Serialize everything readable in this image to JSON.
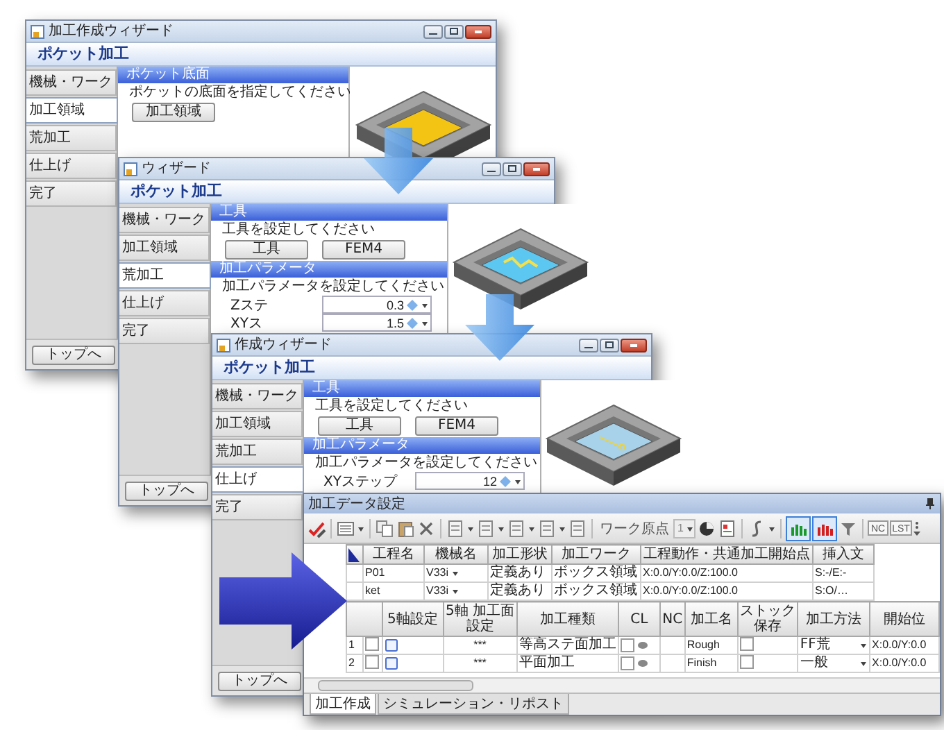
{
  "windows": [
    {
      "title": "加工作成ウィザード",
      "heading": "ポケット加工",
      "steps": [
        {
          "label": "機械・ワーク",
          "selected": false
        },
        {
          "label": "加工領域",
          "selected": true
        },
        {
          "label": "荒加工",
          "selected": false
        },
        {
          "label": "仕上げ",
          "selected": false
        },
        {
          "label": "完了",
          "selected": false
        }
      ],
      "sections": [
        {
          "title": "ポケット底面",
          "rows": [
            {
              "kind": "text",
              "text": "ポケットの底面を指定してください"
            },
            {
              "kind": "buttons",
              "buttons": [
                "加工領域"
              ]
            }
          ]
        }
      ],
      "preview": {
        "kind": "pocket-floor"
      },
      "footer_button": "トップへ"
    },
    {
      "title": "ウィザード",
      "heading": "ポケット加工",
      "steps": [
        {
          "label": "機械・ワーク",
          "selected": false
        },
        {
          "label": "加工領域",
          "selected": false
        },
        {
          "label": "荒加工",
          "selected": true
        },
        {
          "label": "仕上げ",
          "selected": false
        },
        {
          "label": "完了",
          "selected": false
        }
      ],
      "sections": [
        {
          "title": "工具",
          "rows": [
            {
              "kind": "text",
              "text": "工具を設定してください"
            },
            {
              "kind": "buttons",
              "buttons": [
                "工具",
                "FEM4"
              ]
            }
          ]
        },
        {
          "title": "加工パラメータ",
          "rows": [
            {
              "kind": "text",
              "text": "加工パラメータを設定してください"
            },
            {
              "kind": "spin",
              "label": "Zステ",
              "value": "0.3"
            },
            {
              "kind": "spin",
              "label": "XYス",
              "value": "1.5"
            }
          ]
        }
      ],
      "preview": {
        "kind": "roughing-path"
      },
      "footer_button": "トップへ"
    },
    {
      "title": "作成ウィザード",
      "heading": "ポケット加工",
      "steps": [
        {
          "label": "機械・ワーク",
          "selected": false
        },
        {
          "label": "加工領域",
          "selected": false
        },
        {
          "label": "荒加工",
          "selected": false
        },
        {
          "label": "仕上げ",
          "selected": true
        },
        {
          "label": "完了",
          "selected": false
        }
      ],
      "sections": [
        {
          "title": "工具",
          "rows": [
            {
              "kind": "text",
              "text": "工具を設定してください"
            },
            {
              "kind": "buttons",
              "buttons": [
                "工具",
                "FEM4"
              ]
            }
          ]
        },
        {
          "title": "加工パラメータ",
          "rows": [
            {
              "kind": "text",
              "text": "加工パラメータを設定してください"
            },
            {
              "kind": "spin",
              "label": "XYステップ",
              "value": "12"
            }
          ]
        }
      ],
      "preview": {
        "kind": "finish-path"
      },
      "footer_button": "トップへ"
    }
  ],
  "data_window": {
    "title": "加工データ設定",
    "toolbar": {
      "origin_label": "ワーク原点",
      "origin_value": "1",
      "toggles": [
        {
          "pressed": true
        },
        {
          "pressed": true
        }
      ],
      "nc": "NC",
      "lst": "LST"
    },
    "process_table": {
      "columns": [
        "工程名",
        "機械名",
        "加工形状",
        "加工ワーク",
        "工程動作・共通加工開始点",
        "挿入文"
      ],
      "rows": [
        {
          "name": "P01",
          "machine": "V33i",
          "shape": "定義あり",
          "work": "ボックス領域",
          "start": "X:0.0/Y:0.0/Z:100.0",
          "insert": "S:-/E:-"
        },
        {
          "name": "ket",
          "machine": "V33i",
          "shape": "定義あり",
          "work": "ボックス領域",
          "start": "X:0.0/Y:0.0/Z:100.0",
          "insert": "S:O/…"
        }
      ]
    },
    "operation_table": {
      "columns": [
        "5軸設定",
        "5軸 加工面設定",
        "加工種類",
        "CL",
        "NC",
        "加工名",
        "ストック保存",
        "加工方法",
        "開始位"
      ],
      "rows": [
        {
          "no": "1",
          "checked": false,
          "face": "***",
          "type": "等高ステ面加工",
          "cl": false,
          "name": "Rough",
          "stock": false,
          "method": "FF荒",
          "start": "X:0.0/Y:0.0"
        },
        {
          "no": "2",
          "checked": false,
          "face": "***",
          "type": "平面加工",
          "cl": false,
          "name": "Finish",
          "stock": false,
          "method": "一般",
          "start": "X:0.0/Y:0.0"
        }
      ]
    },
    "tabs": [
      {
        "label": "加工作成",
        "selected": true
      },
      {
        "label": "シミュレーション・リポスト",
        "selected": false
      }
    ]
  }
}
